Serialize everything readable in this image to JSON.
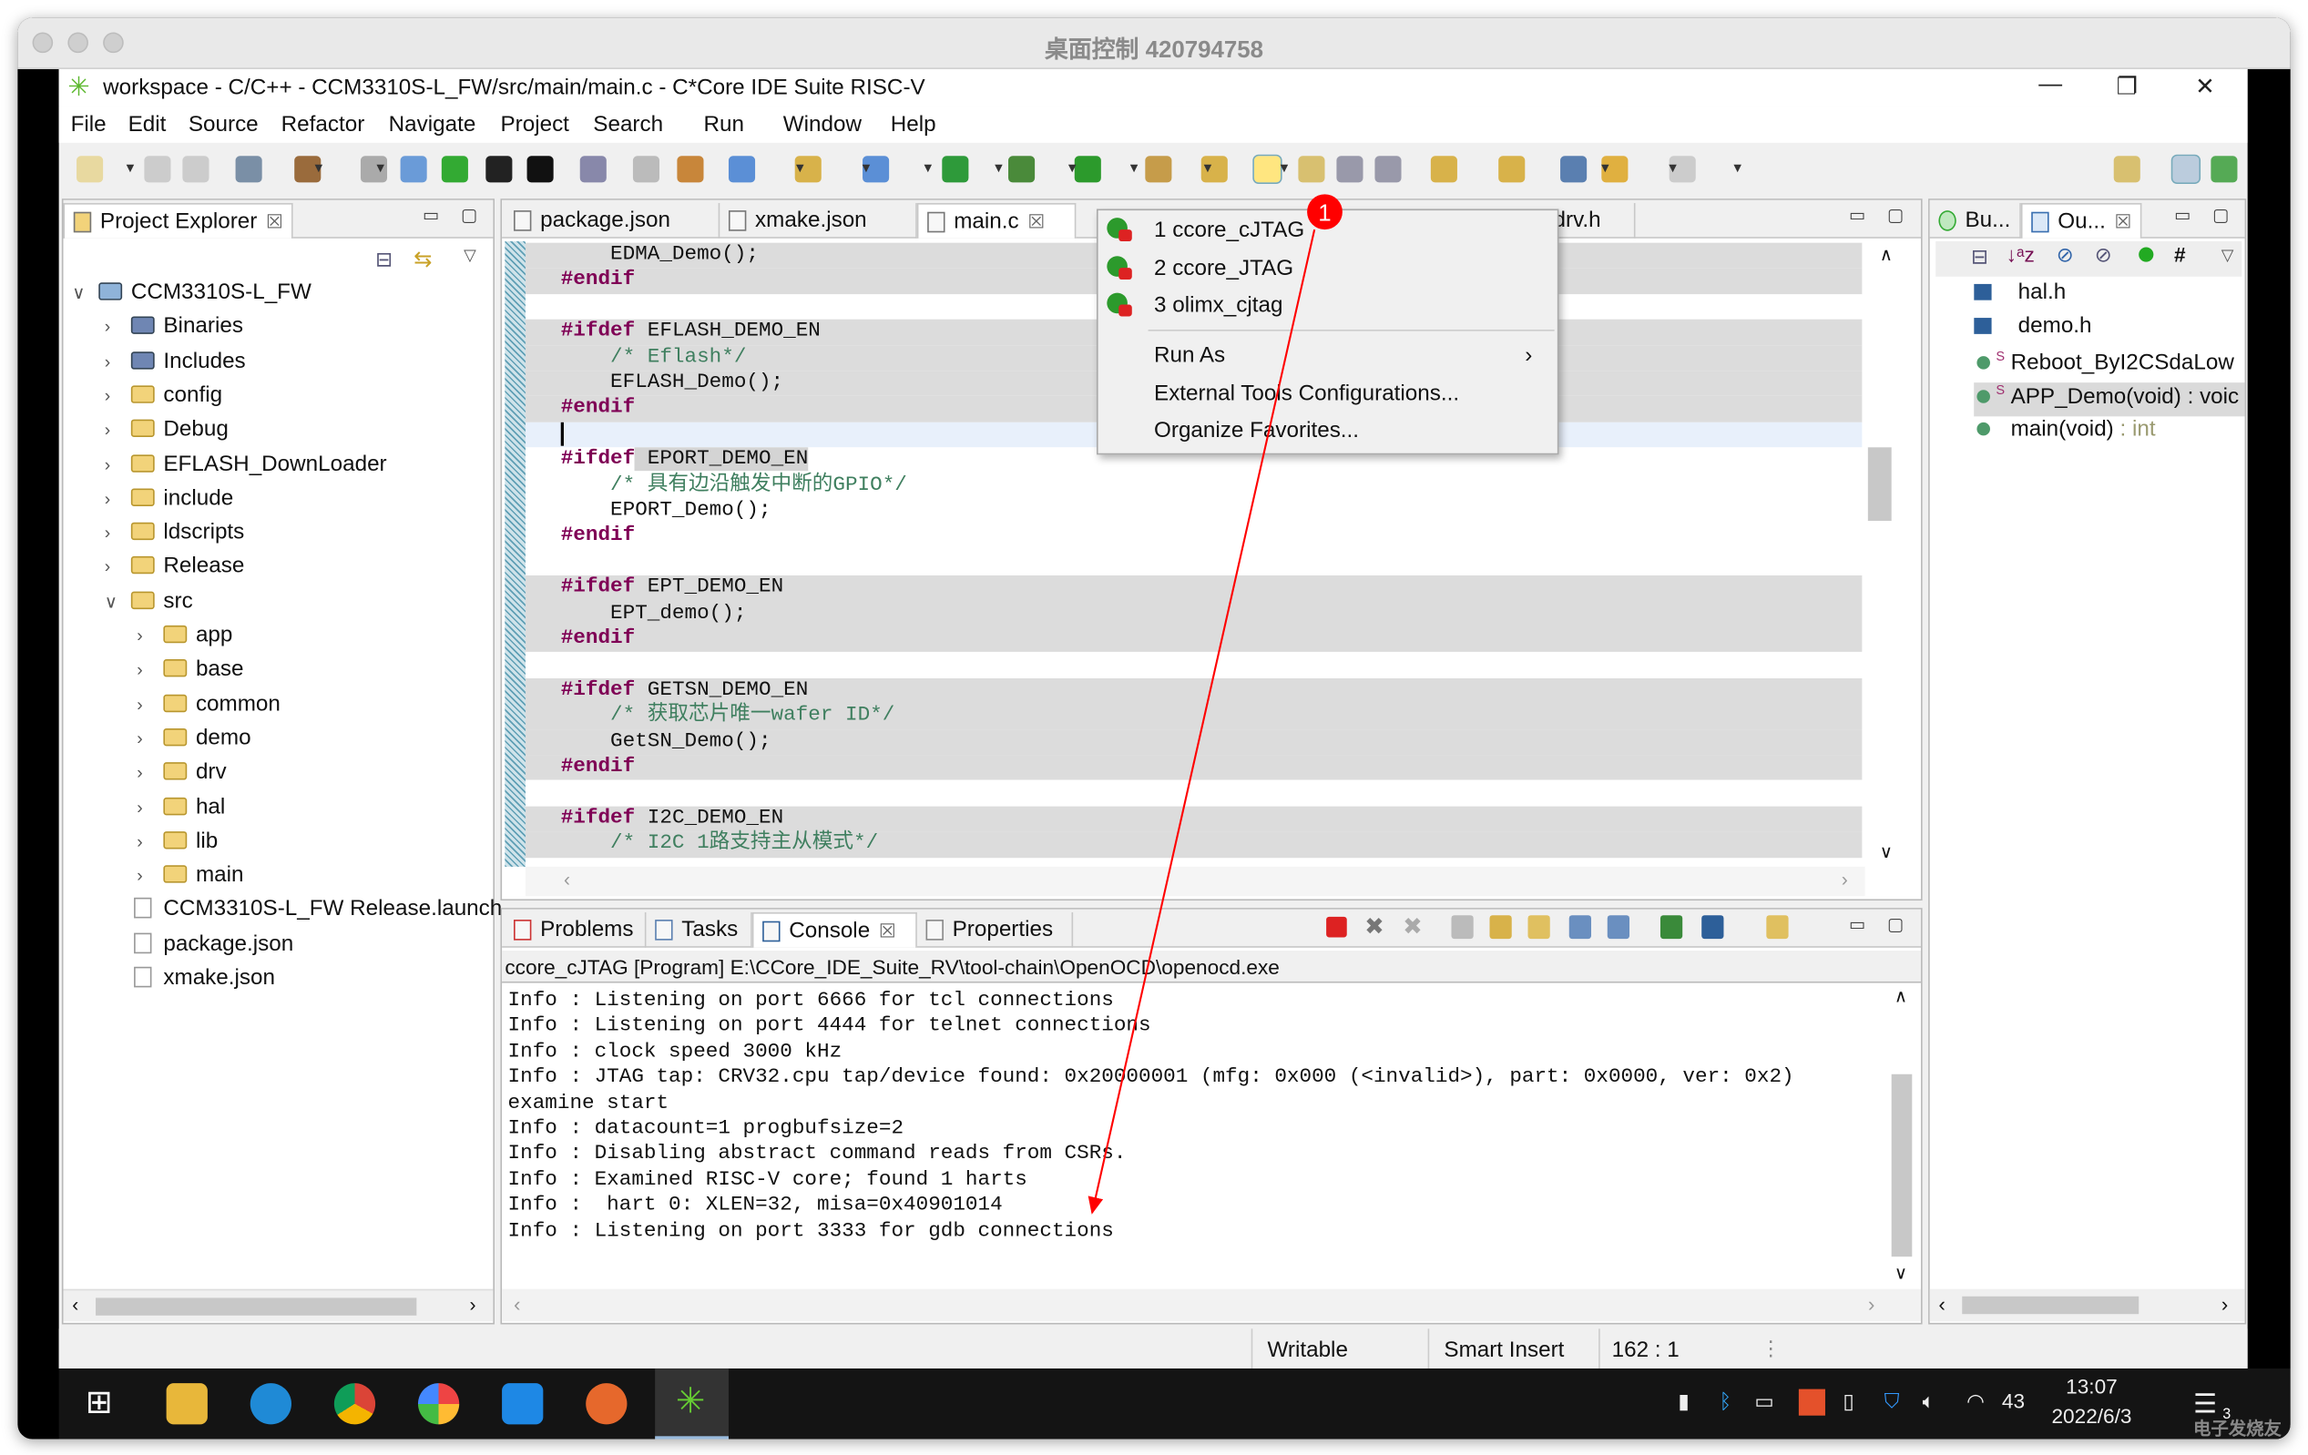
{
  "mac": {
    "title": "桌面控制 420794758"
  },
  "window": {
    "title": "workspace - C/C++ - CCM3310S-L_FW/src/main/main.c - C*Core IDE Suite RISC-V",
    "minimize": "—",
    "restore": "❐",
    "close": "✕"
  },
  "menu": [
    "File",
    "Edit",
    "Source",
    "Refactor",
    "Navigate",
    "Project",
    "Search",
    "Run",
    "Window",
    "Help"
  ],
  "explorer": {
    "tab": "Project Explorer",
    "tree": [
      {
        "label": "CCM3310S-L_FW",
        "level": 0,
        "chev": "∨",
        "icon": "project"
      },
      {
        "label": "Binaries",
        "level": 1,
        "chev": "›",
        "icon": "binaries"
      },
      {
        "label": "Includes",
        "level": 1,
        "chev": "›",
        "icon": "includes"
      },
      {
        "label": "config",
        "level": 1,
        "chev": "›",
        "icon": "folder"
      },
      {
        "label": "Debug",
        "level": 1,
        "chev": "›",
        "icon": "folder"
      },
      {
        "label": "EFLASH_DownLoader",
        "level": 1,
        "chev": "›",
        "icon": "folder"
      },
      {
        "label": "include",
        "level": 1,
        "chev": "›",
        "icon": "folder"
      },
      {
        "label": "ldscripts",
        "level": 1,
        "chev": "›",
        "icon": "folder"
      },
      {
        "label": "Release",
        "level": 1,
        "chev": "›",
        "icon": "folder"
      },
      {
        "label": "src",
        "level": 1,
        "chev": "∨",
        "icon": "folder"
      },
      {
        "label": "app",
        "level": 2,
        "chev": "›",
        "icon": "folder"
      },
      {
        "label": "base",
        "level": 2,
        "chev": "›",
        "icon": "folder"
      },
      {
        "label": "common",
        "level": 2,
        "chev": "›",
        "icon": "folder"
      },
      {
        "label": "demo",
        "level": 2,
        "chev": "›",
        "icon": "folder"
      },
      {
        "label": "drv",
        "level": 2,
        "chev": "›",
        "icon": "folder"
      },
      {
        "label": "hal",
        "level": 2,
        "chev": "›",
        "icon": "folder"
      },
      {
        "label": "lib",
        "level": 2,
        "chev": "›",
        "icon": "folder"
      },
      {
        "label": "main",
        "level": 2,
        "chev": "›",
        "icon": "folder"
      },
      {
        "label": "CCM3310S-L_FW Release.launch",
        "level": 1,
        "chev": "",
        "icon": "file"
      },
      {
        "label": "package.json",
        "level": 1,
        "chev": "",
        "icon": "file"
      },
      {
        "label": "xmake.json",
        "level": 1,
        "chev": "",
        "icon": "file"
      }
    ]
  },
  "editor": {
    "tabs": [
      {
        "label": "package.json",
        "active": false
      },
      {
        "label": "xmake.json",
        "active": false
      },
      {
        "label": "main.c",
        "active": true
      },
      {
        "label": "_drv.h",
        "active": false
      }
    ],
    "lines": [
      {
        "kw": "",
        "text": "    EDMA_Demo();",
        "kind": "code",
        "shade": "gray"
      },
      {
        "kw": "#endif",
        "text": "",
        "kind": "dir",
        "shade": "gray"
      },
      {
        "kw": "",
        "text": "",
        "kind": "code",
        "shade": "white"
      },
      {
        "kw": "#ifdef",
        "text": " EFLASH_DEMO_EN",
        "kind": "dir",
        "shade": "gray"
      },
      {
        "kw": "",
        "text": "    /* Eflash*/",
        "kind": "cmt",
        "shade": "gray"
      },
      {
        "kw": "",
        "text": "    EFLASH_Demo();",
        "kind": "code",
        "shade": "gray"
      },
      {
        "kw": "#endif",
        "text": "",
        "kind": "dir",
        "shade": "gray"
      },
      {
        "kw": "",
        "text": "",
        "kind": "code",
        "shade": "cursor"
      },
      {
        "kw": "#ifdef",
        "text": " EPORT_DEMO_EN",
        "kind": "dir",
        "shade": "white"
      },
      {
        "kw": "",
        "text": "    /* 具有边沿触发中断的GPIO*/",
        "kind": "cmt",
        "shade": "white"
      },
      {
        "kw": "",
        "text": "    EPORT_Demo();",
        "kind": "code",
        "shade": "white"
      },
      {
        "kw": "#endif",
        "text": "",
        "kind": "dir",
        "shade": "white"
      },
      {
        "kw": "",
        "text": "",
        "kind": "code",
        "shade": "white"
      },
      {
        "kw": "#ifdef",
        "text": " EPT_DEMO_EN",
        "kind": "dir",
        "shade": "gray"
      },
      {
        "kw": "",
        "text": "    EPT_demo();",
        "kind": "code",
        "shade": "gray"
      },
      {
        "kw": "#endif",
        "text": "",
        "kind": "dir",
        "shade": "gray"
      },
      {
        "kw": "",
        "text": "",
        "kind": "code",
        "shade": "white"
      },
      {
        "kw": "#ifdef",
        "text": " GETSN_DEMO_EN",
        "kind": "dir",
        "shade": "gray"
      },
      {
        "kw": "",
        "text": "    /* 获取芯片唯一wafer ID*/",
        "kind": "cmt",
        "shade": "gray"
      },
      {
        "kw": "",
        "text": "    GetSN_Demo();",
        "kind": "code",
        "shade": "gray"
      },
      {
        "kw": "#endif",
        "text": "",
        "kind": "dir",
        "shade": "gray"
      },
      {
        "kw": "",
        "text": "",
        "kind": "code",
        "shade": "white"
      },
      {
        "kw": "#ifdef",
        "text": " I2C_DEMO_EN",
        "kind": "dir",
        "shade": "gray"
      },
      {
        "kw": "",
        "text": "    /* I2C 1路支持主从模式*/",
        "kind": "cmt",
        "shade": "gray"
      }
    ]
  },
  "run_menu": {
    "items": [
      "1 ccore_cJTAG",
      "2 ccore_JTAG",
      "3 olimx_cjtag"
    ],
    "run_as": "Run As",
    "external_tools": "External Tools Configurations...",
    "organize": "Organize Favorites..."
  },
  "annotation": {
    "badge": "1",
    "color": "#ff0000"
  },
  "outline": {
    "tabs": [
      "Bu...",
      "Ou..."
    ],
    "items": [
      {
        "label": "hal.h",
        "suffix": "",
        "icon": "include",
        "static": ""
      },
      {
        "label": "demo.h",
        "suffix": "",
        "icon": "include",
        "static": ""
      },
      {
        "label": "Reboot_ByI2CSdaLow",
        "suffix": "",
        "icon": "function",
        "static": "S"
      },
      {
        "label": "APP_Demo(void) : voic",
        "suffix": "",
        "icon": "function",
        "static": "S",
        "selected": true
      },
      {
        "label": "main(void)",
        "suffix": " : int",
        "icon": "function",
        "static": ""
      }
    ]
  },
  "console": {
    "tabs": [
      "Problems",
      "Tasks",
      "Console",
      "Properties"
    ],
    "header": "ccore_cJTAG [Program] E:\\CCore_IDE_Suite_RV\\tool-chain\\OpenOCD\\openocd.exe",
    "lines": [
      "Info : Listening on port 6666 for tcl connections",
      "Info : Listening on port 4444 for telnet connections",
      "Info : clock speed 3000 kHz",
      "Info : JTAG tap: CRV32.cpu tap/device found: 0x20000001 (mfg: 0x000 (<invalid>), part: 0x0000, ver: 0x2)",
      "examine start",
      "Info : datacount=1 progbufsize=2",
      "Info : Disabling abstract command reads from CSRs.",
      "Info : Examined RISC-V core; found 1 harts",
      "Info :  hart 0: XLEN=32, misa=0x40901014",
      "Info : Listening on port 3333 for gdb connections"
    ]
  },
  "status": {
    "writable": "Writable",
    "insert": "Smart Insert",
    "position": "162 : 1"
  },
  "taskbar": {
    "time": "13:07",
    "date": "2022/6/3",
    "battery": "43",
    "notifications": "3"
  },
  "watermark": "电子发烧友"
}
